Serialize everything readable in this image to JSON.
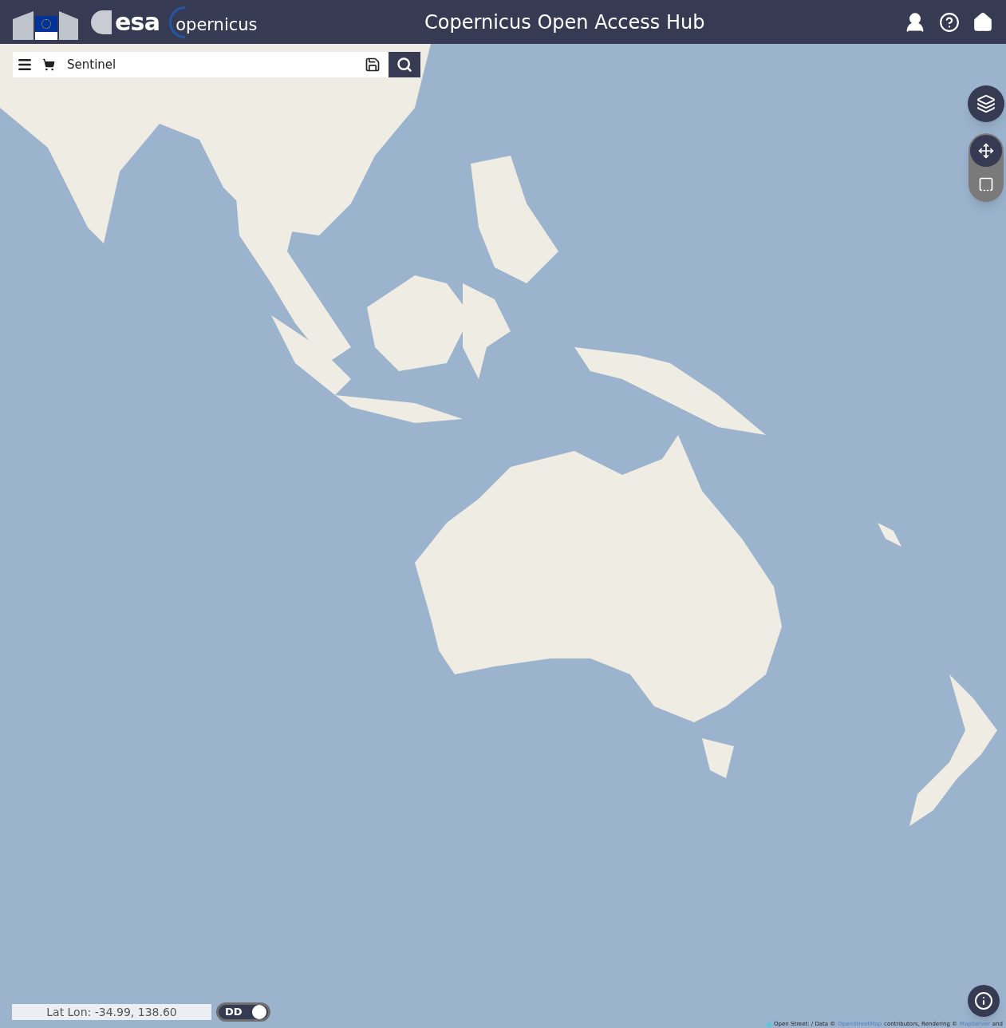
{
  "header": {
    "logos": {
      "esa": "esa",
      "copernicus": "opernicus"
    },
    "title": "Copernicus Open Access Hub"
  },
  "search": {
    "value": "Sentinel"
  },
  "coordinates": {
    "label": "Lat Lon: -34.99, 138.60"
  },
  "format_toggle": {
    "label": "DD",
    "on": true
  },
  "map_tools": [
    {
      "kind": "layers",
      "selected": false
    },
    {
      "kind": "pan",
      "selected": true
    },
    {
      "kind": "select",
      "selected": false
    }
  ],
  "attribution": {
    "prefix": "Open Street: / Data ©",
    "link_1": "OpenStreetMap",
    "middle": "contributors, Rendering ©",
    "link_2": "MapServer",
    "suffix": "and"
  }
}
